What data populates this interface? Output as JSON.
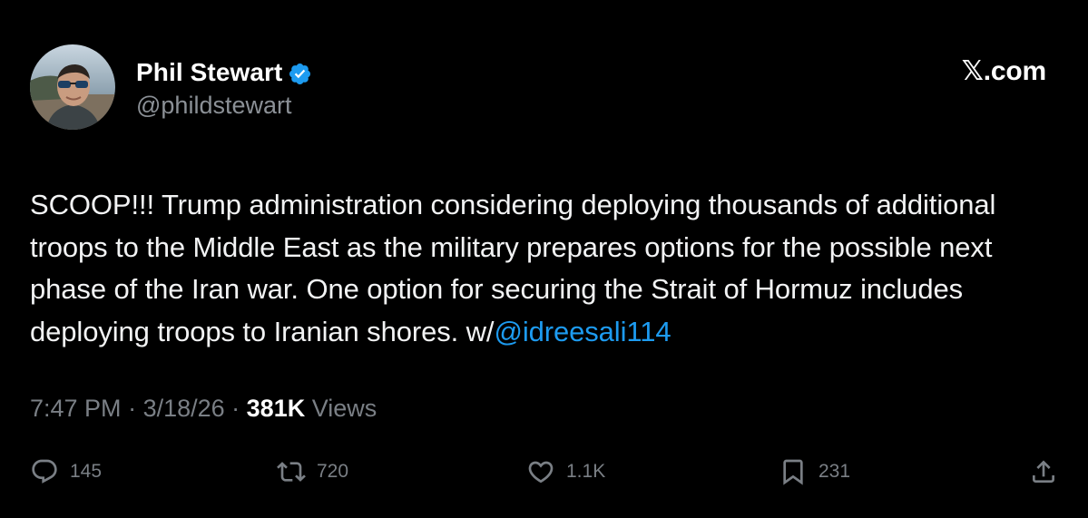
{
  "tweet": {
    "author": {
      "display_name": "Phil Stewart",
      "handle": "@phildstewart",
      "verified": true,
      "avatar": "profile-photo"
    },
    "source_label": "𝕏.com",
    "body": {
      "text": "SCOOP!!! Trump administration considering deploying thousands of additional troops to the Middle East as the military prepares options for the possible next phase of the Iran war. One option for securing the Strait of Hormuz includes deploying troops to Iranian shores. w/",
      "mention": "@idreesali114"
    },
    "meta": {
      "time": "7:47 PM",
      "separator": " · ",
      "date": "3/18/26",
      "views_count": "381K",
      "views_label": " Views"
    },
    "actions": {
      "replies": {
        "icon": "reply-icon",
        "count": "145"
      },
      "reposts": {
        "icon": "repost-icon",
        "count": "720"
      },
      "likes": {
        "icon": "heart-icon",
        "count": "1.1K"
      },
      "bookmarks": {
        "icon": "bookmark-icon",
        "count": "231"
      },
      "share": {
        "icon": "share-icon"
      }
    }
  },
  "colors": {
    "background": "#000000",
    "text_primary": "#e7e9ea",
    "text_secondary": "#7a7f85",
    "accent": "#1d9bf0"
  }
}
